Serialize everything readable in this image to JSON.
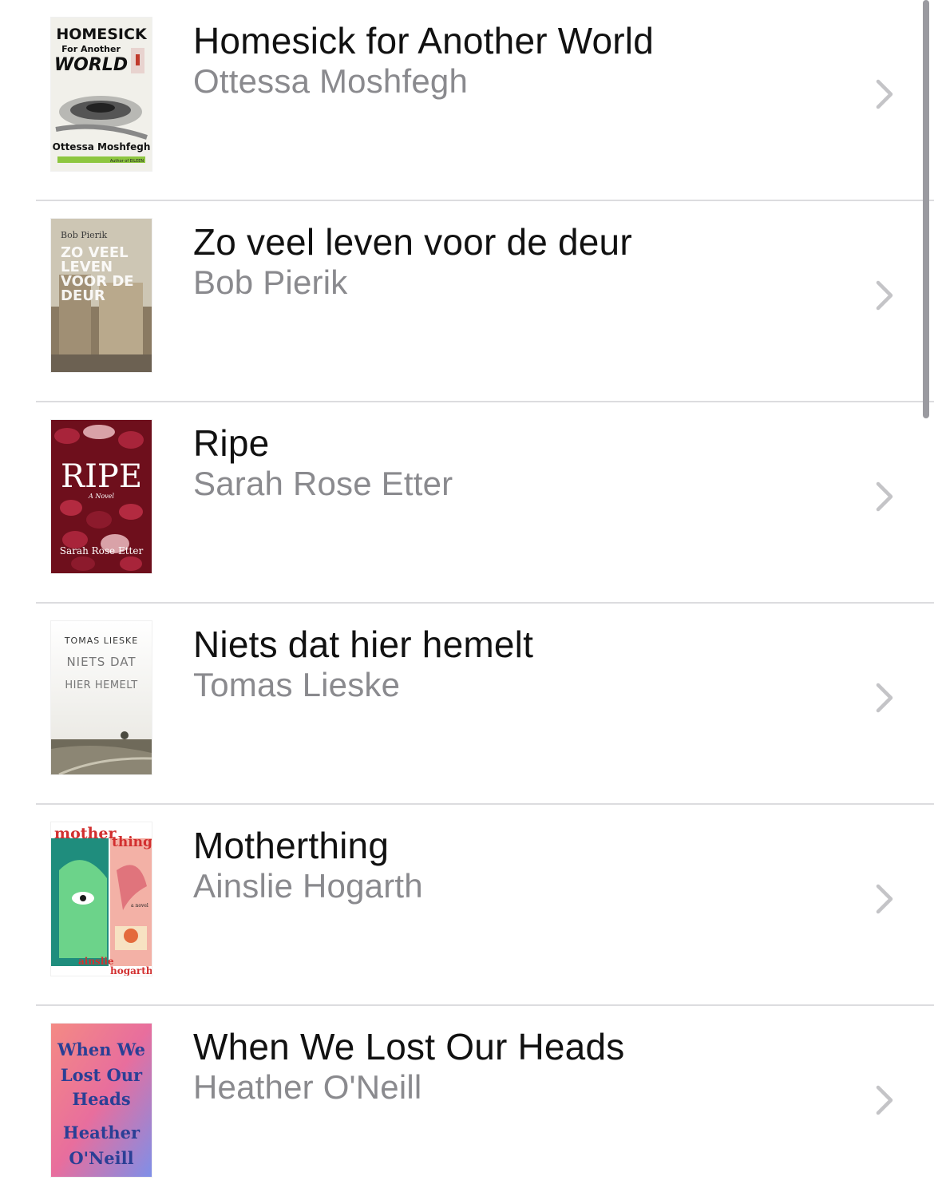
{
  "books": [
    {
      "title": "Homesick for Another World",
      "author": "Ottessa Moshfegh",
      "cover": {
        "top": "HOMESICK",
        "mid": "For Another",
        "big": "WORLD",
        "bottom": "Ottessa Moshfegh",
        "tag": "Author of EILEEN"
      }
    },
    {
      "title": "Zo veel leven voor de deur",
      "author": "Bob Pierik",
      "cover": {
        "top": "Bob Pierik",
        "l1": "ZO VEEL",
        "l2": "LEVEN",
        "l3": "VOOR DE",
        "l4": "DEUR"
      }
    },
    {
      "title": "Ripe",
      "author": "Sarah Rose Etter",
      "cover": {
        "big": "RIPE",
        "sub": "A Novel",
        "bottom": "Sarah Rose Etter"
      }
    },
    {
      "title": "Niets dat hier hemelt",
      "author": "Tomas Lieske",
      "cover": {
        "top": "TOMAS LIESKE",
        "l1": "NIETS DAT",
        "l2": "HIER HEMELT"
      }
    },
    {
      "title": "Motherthing",
      "author": "Ainslie Hogarth",
      "cover": {
        "a": "mother",
        "b": "thing",
        "c": "ainslie",
        "d": "hogarth",
        "e": "a novel"
      }
    },
    {
      "title": "When We Lost Our Heads",
      "author": "Heather O'Neill",
      "cover": {
        "l1": "When We",
        "l2": "Lost Our",
        "l3": "Heads",
        "l4": "Heather",
        "l5": "O'Neill"
      }
    }
  ],
  "icons": {
    "chevron": "chevron-right-icon"
  },
  "colors": {
    "title": "#111111",
    "author": "#8a8a8e",
    "divider": "#dcdcdf",
    "chevron": "#c4c4c7"
  }
}
